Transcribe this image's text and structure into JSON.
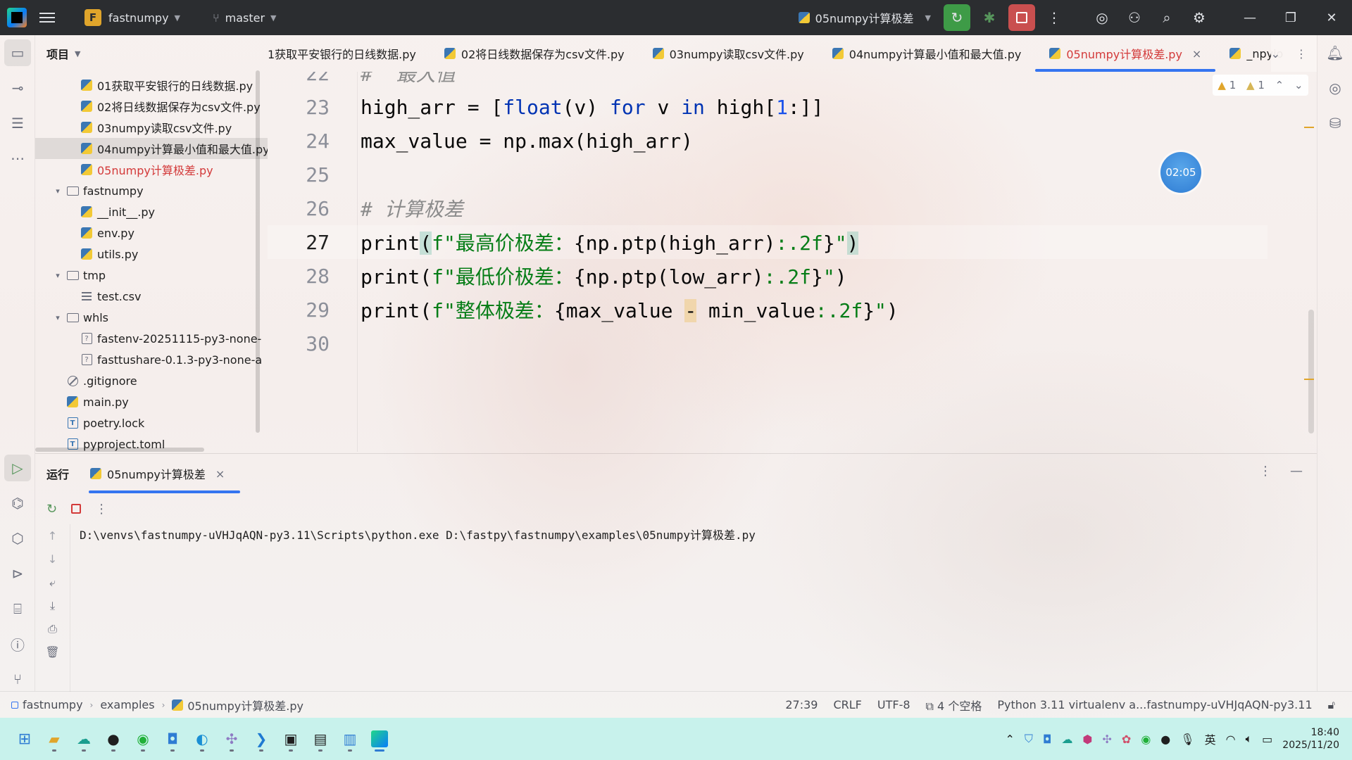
{
  "titlebar": {
    "project_letter": "F",
    "project_name": "fastnumpy",
    "branch": "master",
    "run_config": "05numpy计算极差"
  },
  "project_panel": {
    "title": "项目",
    "tree": [
      {
        "label": "01获取平安银行的日线数据.py",
        "type": "py",
        "indent": 3,
        "state": ""
      },
      {
        "label": "02将日线数据保存为csv文件.py",
        "type": "py",
        "indent": 3,
        "state": ""
      },
      {
        "label": "03numpy读取csv文件.py",
        "type": "py",
        "indent": 3,
        "state": ""
      },
      {
        "label": "04numpy计算最小值和最大值.py",
        "type": "py",
        "indent": 3,
        "state": "selected"
      },
      {
        "label": "05numpy计算极差.py",
        "type": "py",
        "indent": 3,
        "state": "red"
      },
      {
        "label": "fastnumpy",
        "type": "folder",
        "indent": 2,
        "state": "",
        "expanded": true
      },
      {
        "label": "__init__.py",
        "type": "py",
        "indent": 3,
        "state": ""
      },
      {
        "label": "env.py",
        "type": "py",
        "indent": 3,
        "state": ""
      },
      {
        "label": "utils.py",
        "type": "py",
        "indent": 3,
        "state": ""
      },
      {
        "label": "tmp",
        "type": "folder",
        "indent": 2,
        "state": "",
        "expanded": true
      },
      {
        "label": "test.csv",
        "type": "csv",
        "indent": 3,
        "state": ""
      },
      {
        "label": "whls",
        "type": "folder",
        "indent": 2,
        "state": "",
        "expanded": true
      },
      {
        "label": "fastenv-20251115-py3-none-",
        "type": "whl",
        "indent": 3,
        "state": ""
      },
      {
        "label": "fasttushare-0.1.3-py3-none-a",
        "type": "whl",
        "indent": 3,
        "state": ""
      },
      {
        "label": ".gitignore",
        "type": "git",
        "indent": 2,
        "state": ""
      },
      {
        "label": "main.py",
        "type": "py",
        "indent": 2,
        "state": ""
      },
      {
        "label": "poetry.lock",
        "type": "txt",
        "indent": 2,
        "state": ""
      },
      {
        "label": "pyproject.toml",
        "type": "txt",
        "indent": 2,
        "state": ""
      }
    ]
  },
  "tabs": [
    {
      "label": "1获取平安银行的日线数据.py",
      "active": false,
      "icon": false
    },
    {
      "label": "02将日线数据保存为csv文件.py",
      "active": false,
      "icon": true
    },
    {
      "label": "03numpy读取csv文件.py",
      "active": false,
      "icon": true
    },
    {
      "label": "04numpy计算最小值和最大值.py",
      "active": false,
      "icon": true
    },
    {
      "label": "05numpy计算极差.py",
      "active": true,
      "icon": true
    },
    {
      "label": "_npyio",
      "active": false,
      "icon": true
    }
  ],
  "editor": {
    "warnings_a": "1",
    "warnings_b": "1",
    "timer": "02:05",
    "partial_top_comment": "#  最大值",
    "lines": [
      {
        "num": "23"
      },
      {
        "num": "24"
      },
      {
        "num": "25"
      },
      {
        "num": "26"
      },
      {
        "num": "27"
      },
      {
        "num": "28"
      },
      {
        "num": "29"
      },
      {
        "num": "30"
      }
    ],
    "partial_top_num": "22"
  },
  "run_panel": {
    "title": "运行",
    "tab_label": "05numpy计算极差",
    "console_line": "D:\\venvs\\fastnumpy-uVHJqAQN-py3.11\\Scripts\\python.exe D:\\fastpy\\fastnumpy\\examples\\05numpy计算极差.py"
  },
  "statusbar": {
    "crumbs": [
      "fastnumpy",
      "examples",
      "05numpy计算极差.py"
    ],
    "position": "27:39",
    "line_sep": "CRLF",
    "encoding": "UTF-8",
    "indent": "4 个空格",
    "interpreter": "Python 3.11 virtualenv a...fastnumpy-uVHJqAQN-py3.11"
  },
  "taskbar": {
    "ime": "英",
    "time": "18:40",
    "date": "2025/11/20"
  }
}
